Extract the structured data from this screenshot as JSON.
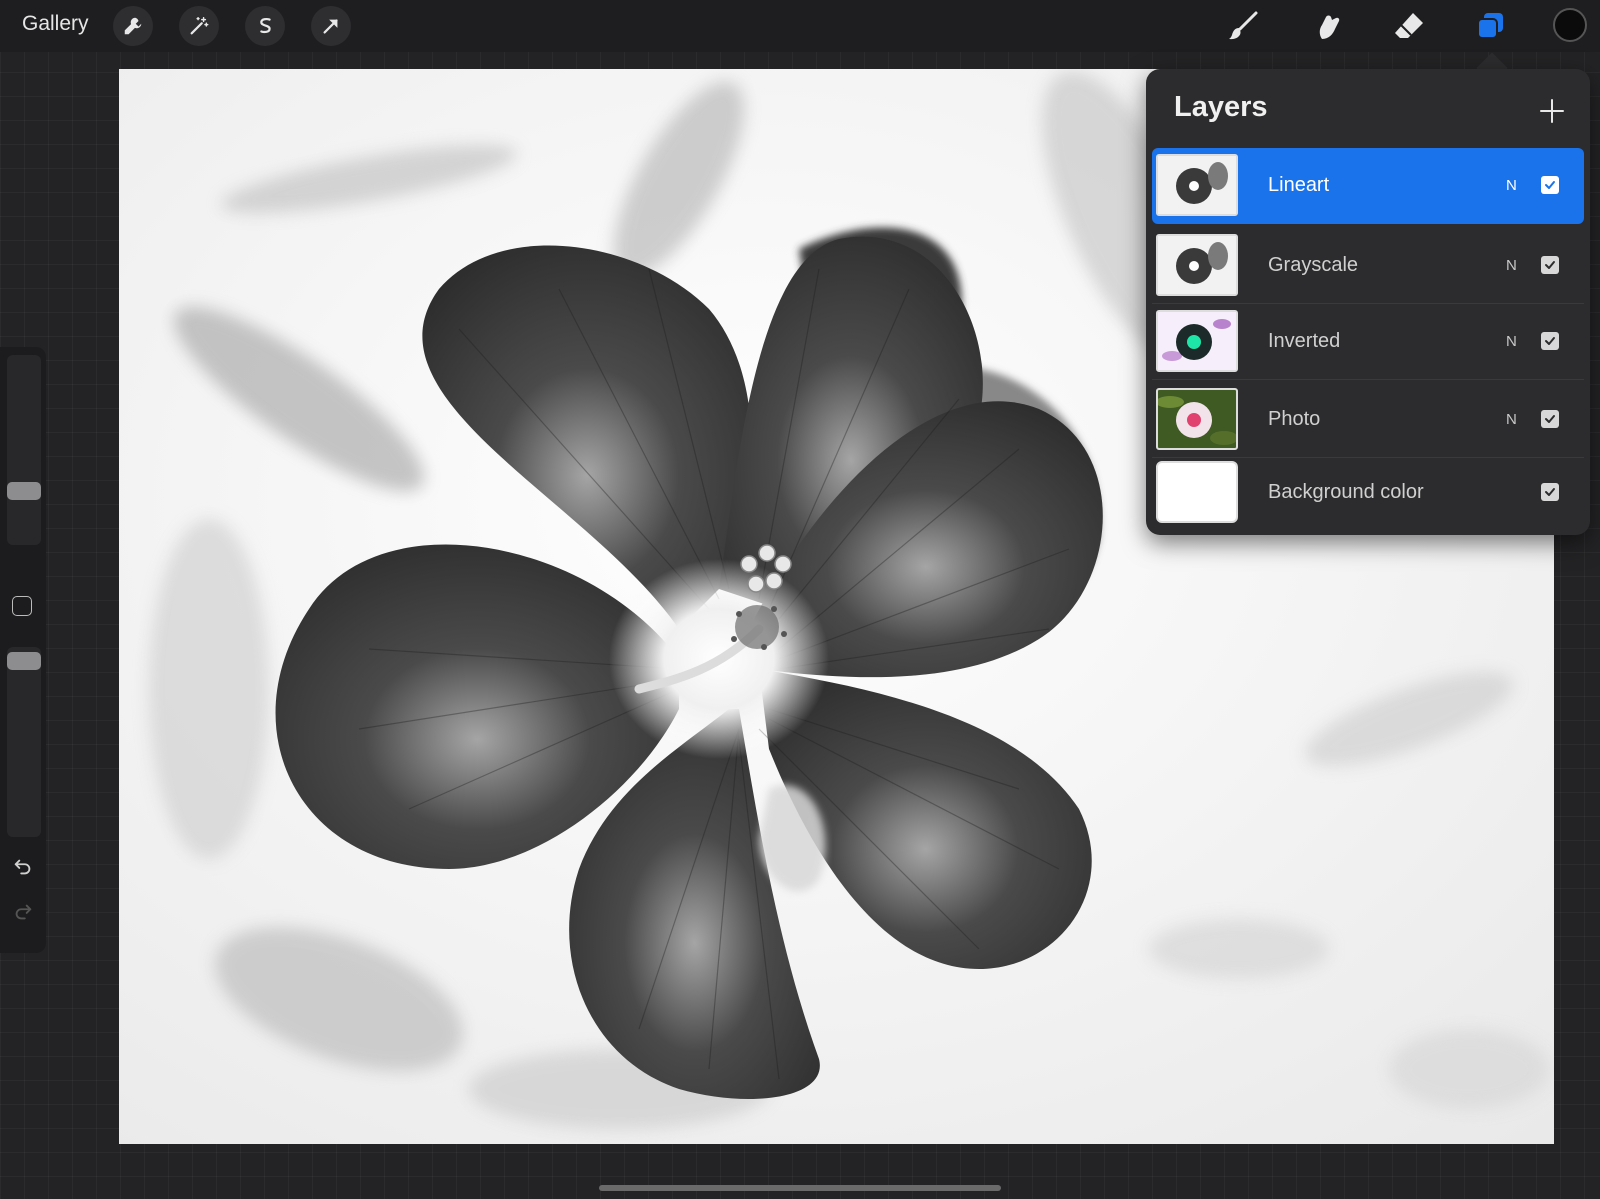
{
  "topbar": {
    "gallery_label": "Gallery",
    "left_tools": [
      "wrench-icon",
      "magic-wand-icon",
      "selection-s-icon",
      "transform-arrow-icon"
    ],
    "right_tools": [
      "brush-icon",
      "smudge-icon",
      "eraser-icon",
      "layers-icon"
    ],
    "active_tool": "layers-icon",
    "current_color": "#0b0b0c",
    "accent_color": "#1a73ea"
  },
  "sidebar": {
    "brush_size_level": 0.26,
    "opacity_level": 0.0,
    "icons": [
      "modify-square-icon",
      "undo-icon",
      "redo-icon"
    ]
  },
  "layers_panel": {
    "title": "Layers",
    "add_icon": "plus-icon",
    "layers": [
      {
        "name": "Lineart",
        "blend": "N",
        "visible": true,
        "selected": true,
        "thumb": "grayscale-flower"
      },
      {
        "name": "Grayscale",
        "blend": "N",
        "visible": true,
        "selected": false,
        "thumb": "grayscale-flower"
      },
      {
        "name": "Inverted",
        "blend": "N",
        "visible": true,
        "selected": false,
        "thumb": "inverted-flower"
      },
      {
        "name": "Photo",
        "blend": "N",
        "visible": true,
        "selected": false,
        "thumb": "photo-flower"
      },
      {
        "name": "Background color",
        "blend": "",
        "visible": true,
        "selected": false,
        "thumb": "white"
      }
    ]
  },
  "canvas": {
    "content": "black-and-white hibiscus flower artwork"
  }
}
